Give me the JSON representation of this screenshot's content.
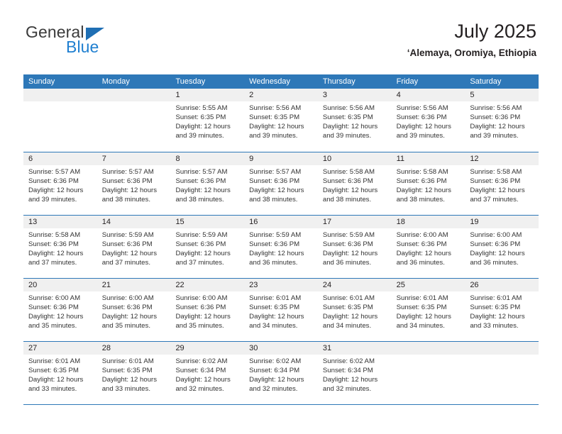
{
  "brand": {
    "name_part1": "General",
    "name_part2": "Blue",
    "accent_color": "#1f7fd0",
    "triangle_color": "#1f6fb4"
  },
  "header": {
    "title": "July 2025",
    "subtitle": "‘Alemaya, Oromiya, Ethiopia"
  },
  "theme": {
    "header_blue": "#2e78b8",
    "day_band_gray": "#f0f0f0",
    "text_color": "#231f20"
  },
  "weekdays": [
    "Sunday",
    "Monday",
    "Tuesday",
    "Wednesday",
    "Thursday",
    "Friday",
    "Saturday"
  ],
  "weeks": [
    [
      {
        "day": "",
        "sunrise": "",
        "sunset": "",
        "daylight_line1": "",
        "daylight_line2": "",
        "empty": true
      },
      {
        "day": "",
        "sunrise": "",
        "sunset": "",
        "daylight_line1": "",
        "daylight_line2": "",
        "empty": true
      },
      {
        "day": "1",
        "sunrise": "Sunrise: 5:55 AM",
        "sunset": "Sunset: 6:35 PM",
        "daylight_line1": "Daylight: 12 hours",
        "daylight_line2": "and 39 minutes."
      },
      {
        "day": "2",
        "sunrise": "Sunrise: 5:56 AM",
        "sunset": "Sunset: 6:35 PM",
        "daylight_line1": "Daylight: 12 hours",
        "daylight_line2": "and 39 minutes."
      },
      {
        "day": "3",
        "sunrise": "Sunrise: 5:56 AM",
        "sunset": "Sunset: 6:35 PM",
        "daylight_line1": "Daylight: 12 hours",
        "daylight_line2": "and 39 minutes."
      },
      {
        "day": "4",
        "sunrise": "Sunrise: 5:56 AM",
        "sunset": "Sunset: 6:36 PM",
        "daylight_line1": "Daylight: 12 hours",
        "daylight_line2": "and 39 minutes."
      },
      {
        "day": "5",
        "sunrise": "Sunrise: 5:56 AM",
        "sunset": "Sunset: 6:36 PM",
        "daylight_line1": "Daylight: 12 hours",
        "daylight_line2": "and 39 minutes."
      }
    ],
    [
      {
        "day": "6",
        "sunrise": "Sunrise: 5:57 AM",
        "sunset": "Sunset: 6:36 PM",
        "daylight_line1": "Daylight: 12 hours",
        "daylight_line2": "and 39 minutes."
      },
      {
        "day": "7",
        "sunrise": "Sunrise: 5:57 AM",
        "sunset": "Sunset: 6:36 PM",
        "daylight_line1": "Daylight: 12 hours",
        "daylight_line2": "and 38 minutes."
      },
      {
        "day": "8",
        "sunrise": "Sunrise: 5:57 AM",
        "sunset": "Sunset: 6:36 PM",
        "daylight_line1": "Daylight: 12 hours",
        "daylight_line2": "and 38 minutes."
      },
      {
        "day": "9",
        "sunrise": "Sunrise: 5:57 AM",
        "sunset": "Sunset: 6:36 PM",
        "daylight_line1": "Daylight: 12 hours",
        "daylight_line2": "and 38 minutes."
      },
      {
        "day": "10",
        "sunrise": "Sunrise: 5:58 AM",
        "sunset": "Sunset: 6:36 PM",
        "daylight_line1": "Daylight: 12 hours",
        "daylight_line2": "and 38 minutes."
      },
      {
        "day": "11",
        "sunrise": "Sunrise: 5:58 AM",
        "sunset": "Sunset: 6:36 PM",
        "daylight_line1": "Daylight: 12 hours",
        "daylight_line2": "and 38 minutes."
      },
      {
        "day": "12",
        "sunrise": "Sunrise: 5:58 AM",
        "sunset": "Sunset: 6:36 PM",
        "daylight_line1": "Daylight: 12 hours",
        "daylight_line2": "and 37 minutes."
      }
    ],
    [
      {
        "day": "13",
        "sunrise": "Sunrise: 5:58 AM",
        "sunset": "Sunset: 6:36 PM",
        "daylight_line1": "Daylight: 12 hours",
        "daylight_line2": "and 37 minutes."
      },
      {
        "day": "14",
        "sunrise": "Sunrise: 5:59 AM",
        "sunset": "Sunset: 6:36 PM",
        "daylight_line1": "Daylight: 12 hours",
        "daylight_line2": "and 37 minutes."
      },
      {
        "day": "15",
        "sunrise": "Sunrise: 5:59 AM",
        "sunset": "Sunset: 6:36 PM",
        "daylight_line1": "Daylight: 12 hours",
        "daylight_line2": "and 37 minutes."
      },
      {
        "day": "16",
        "sunrise": "Sunrise: 5:59 AM",
        "sunset": "Sunset: 6:36 PM",
        "daylight_line1": "Daylight: 12 hours",
        "daylight_line2": "and 36 minutes."
      },
      {
        "day": "17",
        "sunrise": "Sunrise: 5:59 AM",
        "sunset": "Sunset: 6:36 PM",
        "daylight_line1": "Daylight: 12 hours",
        "daylight_line2": "and 36 minutes."
      },
      {
        "day": "18",
        "sunrise": "Sunrise: 6:00 AM",
        "sunset": "Sunset: 6:36 PM",
        "daylight_line1": "Daylight: 12 hours",
        "daylight_line2": "and 36 minutes."
      },
      {
        "day": "19",
        "sunrise": "Sunrise: 6:00 AM",
        "sunset": "Sunset: 6:36 PM",
        "daylight_line1": "Daylight: 12 hours",
        "daylight_line2": "and 36 minutes."
      }
    ],
    [
      {
        "day": "20",
        "sunrise": "Sunrise: 6:00 AM",
        "sunset": "Sunset: 6:36 PM",
        "daylight_line1": "Daylight: 12 hours",
        "daylight_line2": "and 35 minutes."
      },
      {
        "day": "21",
        "sunrise": "Sunrise: 6:00 AM",
        "sunset": "Sunset: 6:36 PM",
        "daylight_line1": "Daylight: 12 hours",
        "daylight_line2": "and 35 minutes."
      },
      {
        "day": "22",
        "sunrise": "Sunrise: 6:00 AM",
        "sunset": "Sunset: 6:36 PM",
        "daylight_line1": "Daylight: 12 hours",
        "daylight_line2": "and 35 minutes."
      },
      {
        "day": "23",
        "sunrise": "Sunrise: 6:01 AM",
        "sunset": "Sunset: 6:35 PM",
        "daylight_line1": "Daylight: 12 hours",
        "daylight_line2": "and 34 minutes."
      },
      {
        "day": "24",
        "sunrise": "Sunrise: 6:01 AM",
        "sunset": "Sunset: 6:35 PM",
        "daylight_line1": "Daylight: 12 hours",
        "daylight_line2": "and 34 minutes."
      },
      {
        "day": "25",
        "sunrise": "Sunrise: 6:01 AM",
        "sunset": "Sunset: 6:35 PM",
        "daylight_line1": "Daylight: 12 hours",
        "daylight_line2": "and 34 minutes."
      },
      {
        "day": "26",
        "sunrise": "Sunrise: 6:01 AM",
        "sunset": "Sunset: 6:35 PM",
        "daylight_line1": "Daylight: 12 hours",
        "daylight_line2": "and 33 minutes."
      }
    ],
    [
      {
        "day": "27",
        "sunrise": "Sunrise: 6:01 AM",
        "sunset": "Sunset: 6:35 PM",
        "daylight_line1": "Daylight: 12 hours",
        "daylight_line2": "and 33 minutes."
      },
      {
        "day": "28",
        "sunrise": "Sunrise: 6:01 AM",
        "sunset": "Sunset: 6:35 PM",
        "daylight_line1": "Daylight: 12 hours",
        "daylight_line2": "and 33 minutes."
      },
      {
        "day": "29",
        "sunrise": "Sunrise: 6:02 AM",
        "sunset": "Sunset: 6:34 PM",
        "daylight_line1": "Daylight: 12 hours",
        "daylight_line2": "and 32 minutes."
      },
      {
        "day": "30",
        "sunrise": "Sunrise: 6:02 AM",
        "sunset": "Sunset: 6:34 PM",
        "daylight_line1": "Daylight: 12 hours",
        "daylight_line2": "and 32 minutes."
      },
      {
        "day": "31",
        "sunrise": "Sunrise: 6:02 AM",
        "sunset": "Sunset: 6:34 PM",
        "daylight_line1": "Daylight: 12 hours",
        "daylight_line2": "and 32 minutes."
      },
      {
        "day": "",
        "sunrise": "",
        "sunset": "",
        "daylight_line1": "",
        "daylight_line2": "",
        "empty": true
      },
      {
        "day": "",
        "sunrise": "",
        "sunset": "",
        "daylight_line1": "",
        "daylight_line2": "",
        "empty": true
      }
    ]
  ]
}
